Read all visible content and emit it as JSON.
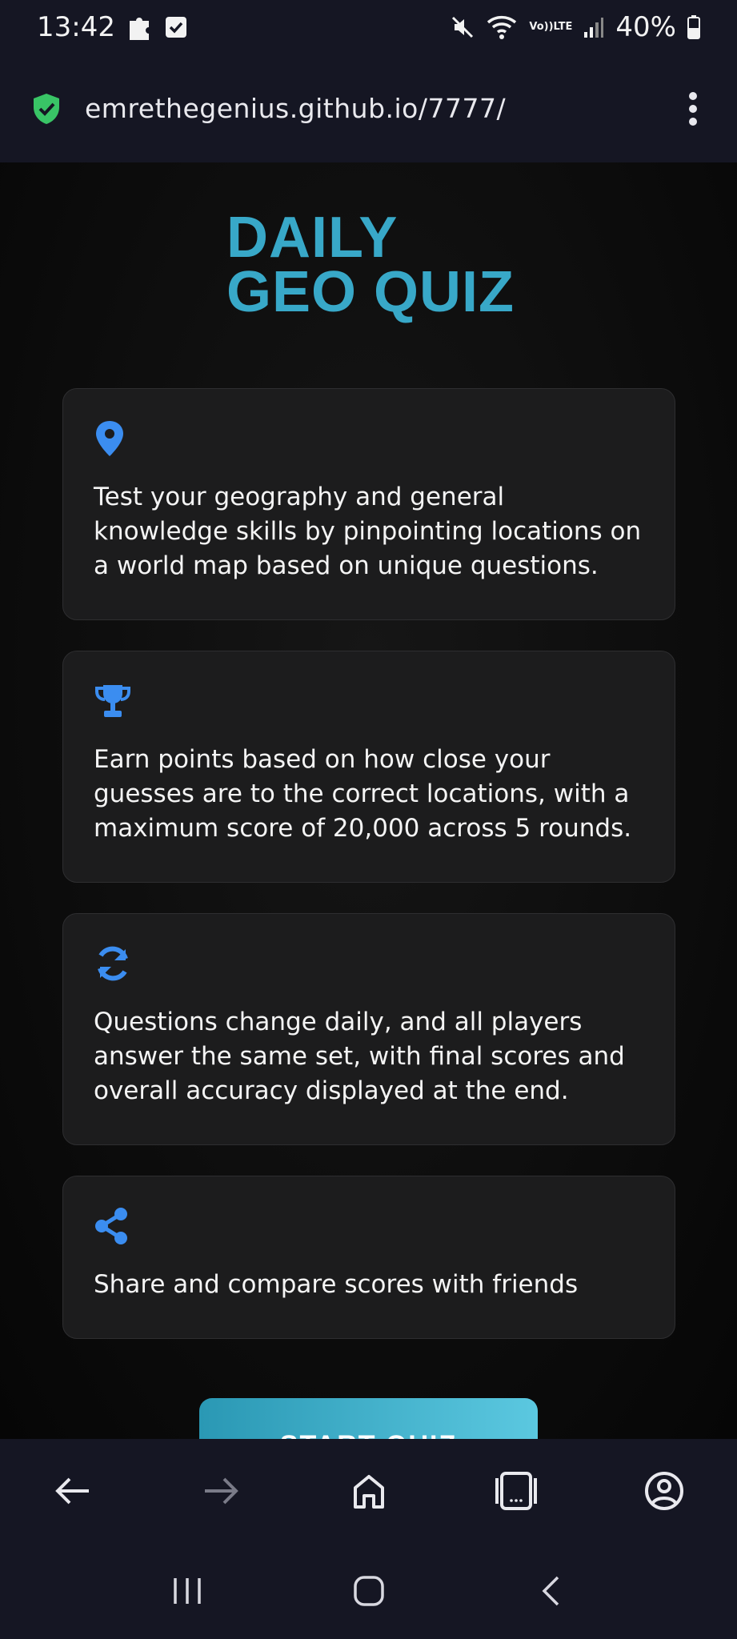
{
  "status_bar": {
    "time": "13:42",
    "battery": "40%",
    "volte_top": "Vo))",
    "volte_bottom": "LTE"
  },
  "address_bar": {
    "url": "emrethegenius.github.io/7777/"
  },
  "page": {
    "title_line1": "DAILY",
    "title_line2": "GEO QUIZ",
    "cards": [
      {
        "icon": "location-pin-icon",
        "text": "Test your geography and general knowledge skills by pinpointing locations on a world map based on unique questions."
      },
      {
        "icon": "trophy-icon",
        "text": "Earn points based on how close your guesses are to the correct locations, with a maximum score of 20,000 across 5 rounds."
      },
      {
        "icon": "refresh-icon",
        "text": "Questions change daily, and all players answer the same set, with final scores and overall accuracy displayed at the end."
      },
      {
        "icon": "share-icon",
        "text": "Share and compare scores with friends"
      }
    ],
    "start_button": "START QUIZ"
  },
  "colors": {
    "accent": "#38a8c8",
    "icon_blue": "#3b8df0",
    "card_bg": "#1c1c1d",
    "bar_bg": "#151623"
  }
}
